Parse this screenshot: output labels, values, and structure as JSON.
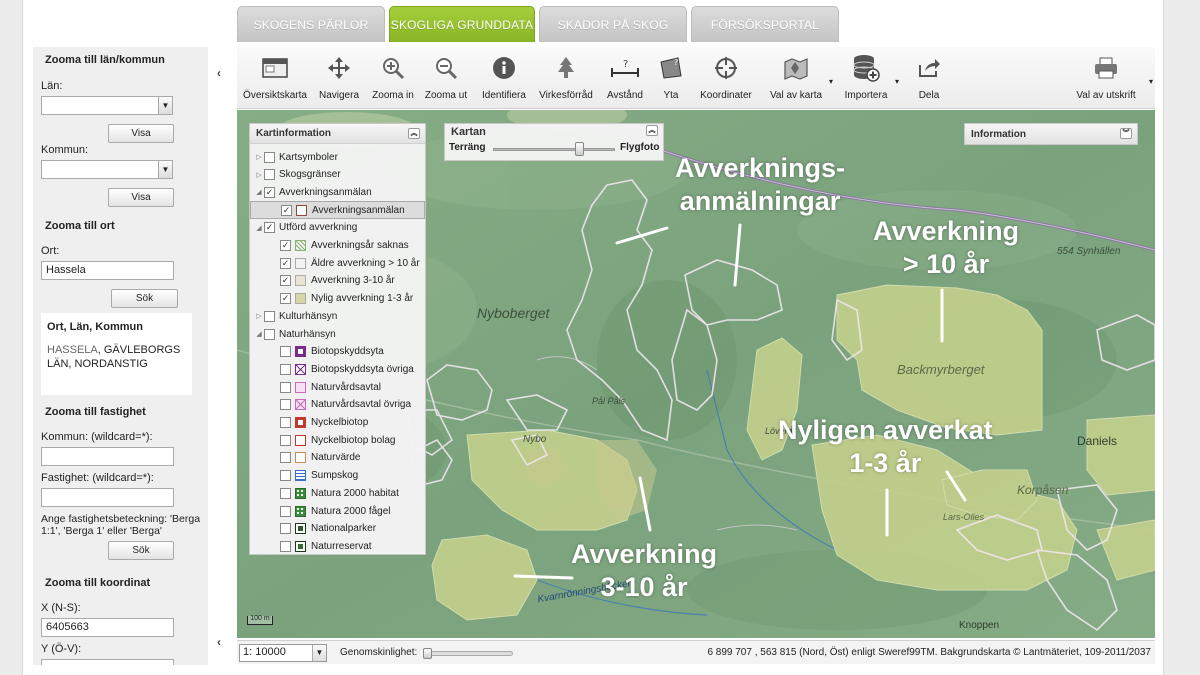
{
  "tabs": [
    {
      "label": "SKOGENS PÄRLOR",
      "active": false
    },
    {
      "label": "SKOGLIGA GRUNDDATA",
      "active": true
    },
    {
      "label": "SKADOR PÅ SKOG",
      "active": false
    },
    {
      "label": "FÖRSÖKSPORTAL",
      "active": false
    }
  ],
  "left": {
    "lan_kommun_title": "Zooma till län/kommun",
    "lan_label": "Län:",
    "visa1": "Visa",
    "kommun_label": "Kommun:",
    "visa2": "Visa",
    "ort_title": "Zooma till ort",
    "ort_label": "Ort:",
    "ort_value": "Hassela",
    "sok1": "Sök",
    "result_title": "Ort, Län, Kommun",
    "result_hl": "HASSELA",
    "result_rest": ", GÄVLEBORGS LÄN, NORDANSTIG",
    "fastighet_title": "Zooma till fastighet",
    "f_kommun_label": "Kommun: (wildcard=*):",
    "f_fastighet_label": "Fastighet: (wildcard=*):",
    "f_hint": "Ange fastighetsbeteckning: 'Berga 1:1', 'Berga 1' eller 'Berga'",
    "sok2": "Sök",
    "koordinat_title": "Zooma till koordinat",
    "x_label": "X (N-S):",
    "x_value": "6405663",
    "y_label": "Y (Ö-V):"
  },
  "toolbar": [
    {
      "label": "Översiktskarta",
      "icon": "overview-map-icon"
    },
    {
      "label": "Navigera",
      "icon": "move-icon"
    },
    {
      "label": "Zooma in",
      "icon": "zoom-in-icon"
    },
    {
      "label": "Zooma ut",
      "icon": "zoom-out-icon"
    },
    {
      "label": "Identifiera",
      "icon": "info-icon"
    },
    {
      "label": "Virkesförråd",
      "icon": "tree-icon"
    },
    {
      "label": "Avstånd",
      "icon": "distance-icon"
    },
    {
      "label": "Yta",
      "icon": "area-icon"
    },
    {
      "label": "Koordinater",
      "icon": "crosshair-icon"
    },
    {
      "label": "Val av karta",
      "icon": "map-select-icon"
    },
    {
      "label": "Importera",
      "icon": "database-add-icon"
    },
    {
      "label": "Dela",
      "icon": "share-icon"
    },
    {
      "label": "Val av utskrift",
      "icon": "printer-icon"
    }
  ],
  "kartinfo": {
    "title": "Kartinformation",
    "layers": [
      {
        "label": "Kartsymboler",
        "checked": false
      },
      {
        "label": "Skogsgränser",
        "checked": false
      },
      {
        "label": "Avverkningsanmälan",
        "checked": true
      },
      {
        "label": "Avverkningsanmälan",
        "checked": true
      },
      {
        "label": "Utförd avverkning",
        "checked": true
      },
      {
        "label": "Avverkningsår saknas",
        "checked": true
      },
      {
        "label": "Äldre avverkning > 10 år",
        "checked": true
      },
      {
        "label": "Avverkning 3-10 år",
        "checked": true
      },
      {
        "label": "Nylig avverkning 1-3 år",
        "checked": true
      },
      {
        "label": "Kulturhänsyn",
        "checked": false
      },
      {
        "label": "Naturhänsyn",
        "checked": false
      },
      {
        "label": "Biotopskyddsyta",
        "checked": false
      },
      {
        "label": "Biotopskyddsyta övriga",
        "checked": false
      },
      {
        "label": "Naturvårdsavtal",
        "checked": false
      },
      {
        "label": "Naturvårdsavtal övriga",
        "checked": false
      },
      {
        "label": "Nyckelbiotop",
        "checked": false
      },
      {
        "label": "Nyckelbiotop bolag",
        "checked": false
      },
      {
        "label": "Naturvärde",
        "checked": false
      },
      {
        "label": "Sumpskog",
        "checked": false
      },
      {
        "label": "Natura 2000 habitat",
        "checked": false
      },
      {
        "label": "Natura 2000 fågel",
        "checked": false
      },
      {
        "label": "Nationalparker",
        "checked": false
      },
      {
        "label": "Naturreservat",
        "checked": false
      }
    ]
  },
  "kartan": {
    "title": "Kartan",
    "left": "Terräng",
    "right": "Flygfoto"
  },
  "information": {
    "title": "Information"
  },
  "overlays": {
    "anm_line1": "Avverknings-",
    "anm_line2": "anmälningar",
    "gt10_line1": "Avverkning",
    "gt10_line2": "> 10 år",
    "new_line1": "Nyligen avverkat",
    "new_line2": "1-3 år",
    "mid_line1": "Avverkning",
    "mid_line2": "3-10 år"
  },
  "places": {
    "synhallen": "554  Synhällen",
    "nyboberget": "Nyboberget",
    "backmyrberget": "Backmyrberget",
    "daniels": "Daniels",
    "korpasen": "Korpåsen",
    "lars_olles": "Lars-Olles",
    "nybo": "Nybo",
    "pal_pals": "Pål Påls",
    "lovera": "Lövera",
    "kvarnronning": "Kvarnrönningsbäcken",
    "knoppen": "Knoppen"
  },
  "scalebar": "100 m",
  "status": {
    "scale": "1: 10000",
    "opacity_label": "Genomskinlighet:",
    "coords": "6 899 707 , 563 815 (Nord, Öst) enligt Sweref99TM. Bakgrundskarta © Lantmäteriet, 109-2011/2037"
  }
}
